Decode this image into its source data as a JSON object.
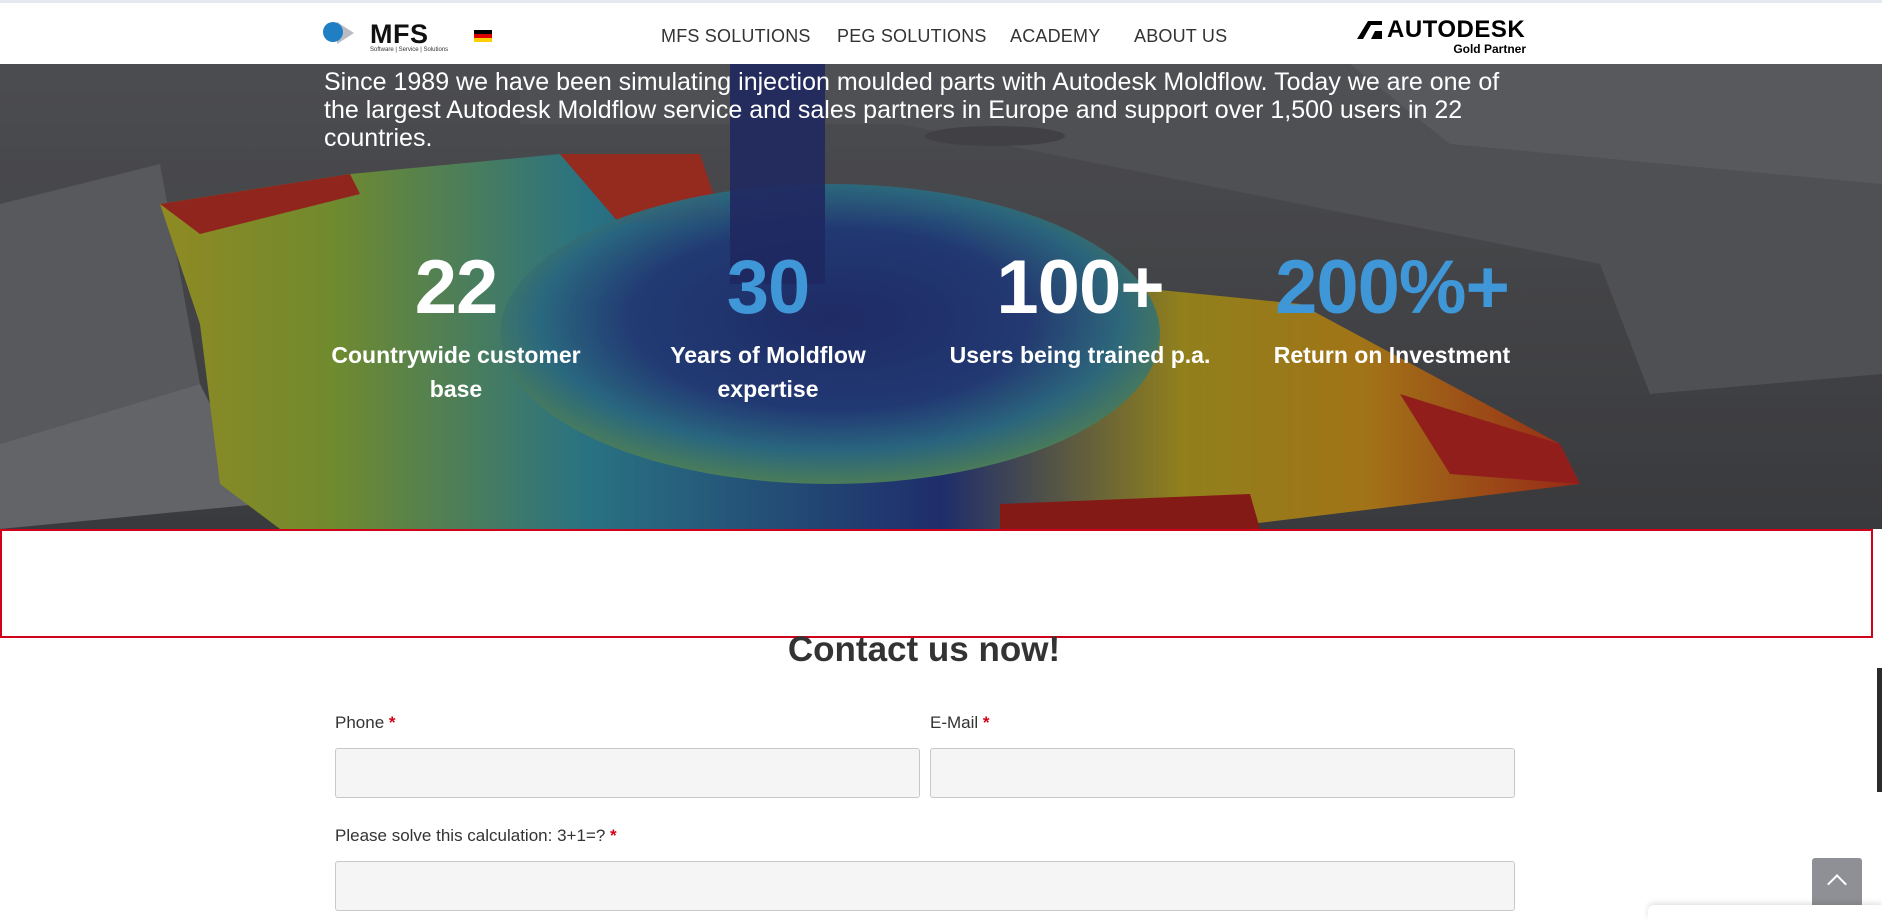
{
  "header": {
    "logo_text": "MFS",
    "logo_tagline": "Software | Service | Solutions",
    "language_flag": "de-flag",
    "nav": [
      {
        "label": "MFS SOLUTIONS"
      },
      {
        "label": "PEG SOLUTIONS"
      },
      {
        "label": "ACADEMY"
      },
      {
        "label": "ABOUT US"
      }
    ],
    "partner_logo": "AUTODESK",
    "partner_level": "Gold Partner"
  },
  "hero": {
    "intro": "Since 1989 we have been simulating injection moulded parts with Autodesk Moldflow. Today we are one of the largest Autodesk Moldflow service and sales partners in Europe and support over 1,500 users in 22 countries.",
    "stats": [
      {
        "value": "22",
        "label": "Countrywide customer base"
      },
      {
        "value": "30",
        "label": "Years of Moldflow expertise"
      },
      {
        "value": "100+",
        "label": "Users being trained p.a."
      },
      {
        "value": "200%+",
        "label": "Return on Investment"
      }
    ]
  },
  "contact": {
    "title": "Contact us now!",
    "phone_label": "Phone",
    "email_label": "E-Mail",
    "captcha_label": "Please solve this calculation: 3+1=?",
    "required_mark": "*",
    "phone_value": "",
    "email_value": "",
    "captcha_value": ""
  },
  "colors": {
    "accent_blue": "#3f97d8",
    "required_red": "#d0021b",
    "highlight_red": "#d0021b"
  }
}
